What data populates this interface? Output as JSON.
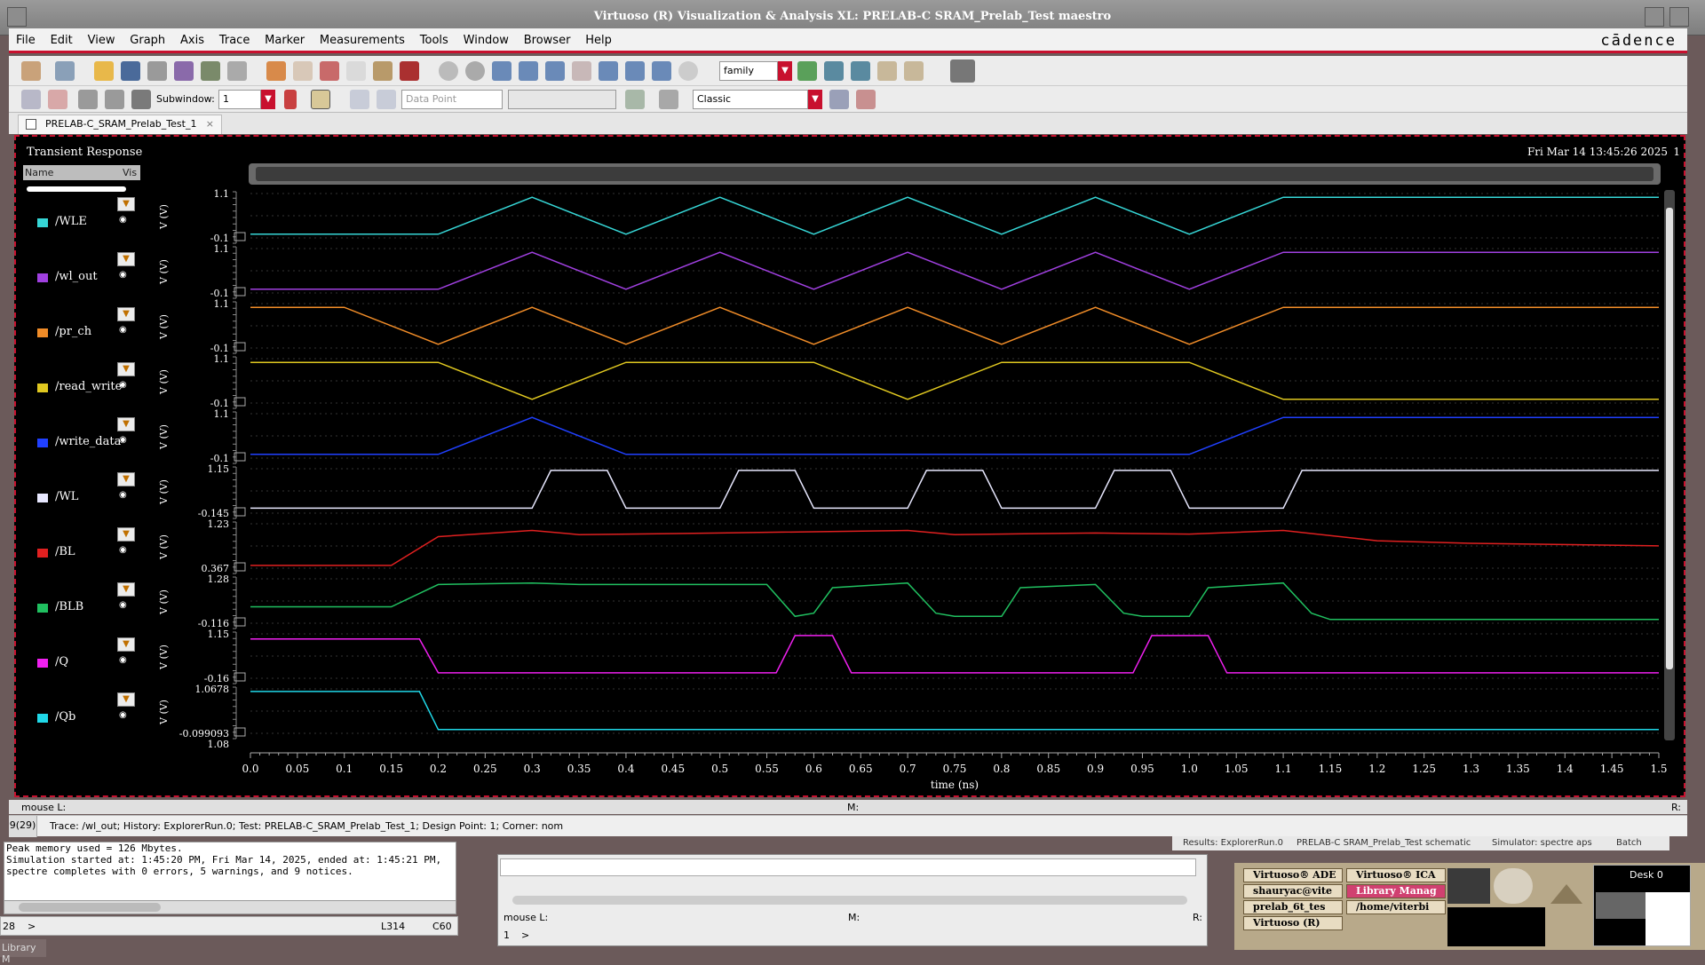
{
  "window": {
    "title": "Virtuoso (R) Visualization & Analysis XL: PRELAB-C SRAM_Prelab_Test maestro"
  },
  "menu": {
    "items": [
      "File",
      "Edit",
      "View",
      "Graph",
      "Axis",
      "Trace",
      "Marker",
      "Measurements",
      "Tools",
      "Window",
      "Browser",
      "Help"
    ],
    "logo": "cādence"
  },
  "toolbar": {
    "family_select": "family",
    "subwindow_label": "Subwindow:",
    "subwindow_value": "1",
    "datapoint_select": "Data Point",
    "style_select": "Classic"
  },
  "tab": {
    "label": "PRELAB-C_SRAM_Prelab_Test_1"
  },
  "plot": {
    "title": "Transient Response",
    "date": "Fri Mar 14 13:45:26 2025",
    "corner_mark": "1",
    "legend_header_name": "Name",
    "legend_header_vis": "Vis",
    "axis_unit_label": "V (V)",
    "extra_axis_top": "1.08"
  },
  "chart_data": {
    "type": "line",
    "xlabel": "time (ns)",
    "xlim": [
      0.0,
      1.5
    ],
    "x_ticks": [
      "0.0",
      "0.05",
      "0.1",
      "0.15",
      "0.2",
      "0.25",
      "0.3",
      "0.35",
      "0.4",
      "0.45",
      "0.5",
      "0.55",
      "0.6",
      "0.65",
      "0.7",
      "0.75",
      "0.8",
      "0.85",
      "0.9",
      "0.95",
      "1.0",
      "1.05",
      "1.1",
      "1.15",
      "1.2",
      "1.25",
      "1.3",
      "1.35",
      "1.4",
      "1.45",
      "1.5"
    ],
    "series": [
      {
        "name": "/WLE",
        "color": "#36d6d6",
        "ymax_label": "1.1",
        "ymin_label": "-0.1",
        "ylim": [
          -0.1,
          1.1
        ],
        "x": [
          0,
          0.2,
          0.3,
          0.4,
          0.5,
          0.6,
          0.7,
          0.8,
          0.9,
          1.0,
          1.1,
          1.5
        ],
        "y": [
          0,
          0,
          1,
          0,
          1,
          0,
          1,
          0,
          1,
          0,
          1,
          1
        ]
      },
      {
        "name": "/wl_out",
        "color": "#a040e0",
        "ymax_label": "1.1",
        "ymin_label": "-0.1",
        "ylim": [
          -0.1,
          1.1
        ],
        "x": [
          0,
          0.2,
          0.3,
          0.4,
          0.5,
          0.6,
          0.7,
          0.8,
          0.9,
          1.0,
          1.1,
          1.5
        ],
        "y": [
          0,
          0,
          1,
          0,
          1,
          0,
          1,
          0,
          1,
          0,
          1,
          1
        ]
      },
      {
        "name": "/pr_ch",
        "color": "#f08c28",
        "ymax_label": "1.1",
        "ymin_label": "-0.1",
        "ylim": [
          -0.1,
          1.1
        ],
        "x": [
          0,
          0.1,
          0.2,
          0.3,
          0.4,
          0.5,
          0.6,
          0.7,
          0.8,
          0.9,
          1.0,
          1.1,
          1.5
        ],
        "y": [
          1,
          1,
          0,
          1,
          0,
          1,
          0,
          1,
          0,
          1,
          0,
          1,
          1
        ]
      },
      {
        "name": "/read_write",
        "color": "#e0c820",
        "ymax_label": "1.1",
        "ymin_label": "-0.1",
        "ylim": [
          -0.1,
          1.1
        ],
        "x": [
          0,
          0.2,
          0.3,
          0.4,
          0.6,
          0.7,
          0.8,
          1.0,
          1.1,
          1.5
        ],
        "y": [
          1,
          1,
          0,
          1,
          1,
          0,
          1,
          1,
          0,
          0
        ]
      },
      {
        "name": "/write_data",
        "color": "#2040ff",
        "ymax_label": "1.1",
        "ymin_label": "-0.1",
        "ylim": [
          -0.1,
          1.1
        ],
        "x": [
          0,
          0.2,
          0.3,
          0.4,
          1.0,
          1.1,
          1.5
        ],
        "y": [
          0,
          0,
          1,
          0,
          0,
          1,
          1
        ]
      },
      {
        "name": "/WL",
        "color": "#e8e8ff",
        "ymax_label": "1.15",
        "ymin_label": "-0.145",
        "ylim": [
          -0.145,
          1.15
        ],
        "x": [
          0,
          0.3,
          0.32,
          0.38,
          0.4,
          0.5,
          0.52,
          0.58,
          0.6,
          0.7,
          0.72,
          0.78,
          0.8,
          0.9,
          0.92,
          0.98,
          1.0,
          1.1,
          1.12,
          1.5
        ],
        "y": [
          0,
          0,
          1.1,
          1.1,
          0,
          0,
          1.1,
          1.1,
          0,
          0,
          1.1,
          1.1,
          0,
          0,
          1.1,
          1.1,
          0,
          0,
          1.1,
          1.1
        ]
      },
      {
        "name": "/BL",
        "color": "#e02020",
        "ymax_label": "1.23",
        "ymin_label": "0.367",
        "ylim": [
          0.367,
          1.23
        ],
        "x": [
          0,
          0.15,
          0.2,
          0.3,
          0.35,
          0.5,
          0.7,
          0.75,
          0.9,
          1.0,
          1.1,
          1.2,
          1.3,
          1.5
        ],
        "y": [
          0.42,
          0.42,
          0.98,
          1.1,
          1.02,
          1.05,
          1.1,
          1.02,
          1.05,
          1.03,
          1.1,
          0.9,
          0.85,
          0.8
        ]
      },
      {
        "name": "/BLB",
        "color": "#20c060",
        "ymax_label": "1.28",
        "ymin_label": "-0.116",
        "ylim": [
          -0.116,
          1.28
        ],
        "x": [
          0,
          0.15,
          0.2,
          0.3,
          0.35,
          0.5,
          0.55,
          0.58,
          0.6,
          0.62,
          0.7,
          0.73,
          0.75,
          0.8,
          0.82,
          0.9,
          0.93,
          0.95,
          1.0,
          1.02,
          1.1,
          1.13,
          1.15,
          1.5
        ],
        "y": [
          0.4,
          0.4,
          1.1,
          1.15,
          1.1,
          1.1,
          1.1,
          0.1,
          0.2,
          1.0,
          1.15,
          0.2,
          0.1,
          0.1,
          1.0,
          1.1,
          0.2,
          0.1,
          0.1,
          1.0,
          1.15,
          0.2,
          0.0,
          0.0
        ]
      },
      {
        "name": "/Q",
        "color": "#f020f0",
        "ymax_label": "1.15",
        "ymin_label": "-0.16",
        "ylim": [
          -0.16,
          1.15
        ],
        "x": [
          0,
          0.18,
          0.2,
          0.56,
          0.58,
          0.62,
          0.64,
          0.94,
          0.96,
          1.02,
          1.04,
          1.5
        ],
        "y": [
          1.0,
          1.0,
          0,
          0,
          1.1,
          1.1,
          0,
          0,
          1.1,
          1.1,
          0,
          0
        ]
      },
      {
        "name": "/Qb",
        "color": "#20d8e8",
        "ymax_label": "1.0678",
        "ymin_label": "-0.099093",
        "ylim": [
          -0.099093,
          1.0678
        ],
        "x": [
          0,
          0.18,
          0.2,
          1.5
        ],
        "y": [
          1.0,
          1.0,
          0,
          0
        ]
      }
    ]
  },
  "status": {
    "mouse_l": "mouse L:",
    "mouse_m": "M:",
    "mouse_r": "R:",
    "index": "9(29)",
    "trace_info": "Trace: /wl_out; History: ExplorerRun.0; Test: PRELAB-C_SRAM_Prelab_Test_1; Design Point: 1; Corner: nom",
    "results": "Results: ExplorerRun.0",
    "schematic": "PRELAB-C SRAM_Prelab_Test schematic",
    "simulator": "Simulator: spectre aps",
    "batch": "Batch"
  },
  "log": {
    "lines": [
      "Peak memory used = 126 Mbytes.",
      "Simulation started at: 1:45:20 PM, Fri Mar 14, 2025, ended at: 1:45:21 PM,",
      "spectre completes with 0 errors, 5 warnings, and 9 notices."
    ],
    "line_no": "28",
    "prompt": ">",
    "pos_line": "L314",
    "pos_col": "C60"
  },
  "midwin": {
    "mouse_l": "mouse L:",
    "mouse_m": "M:",
    "mouse_r": "R:",
    "line_no": "1",
    "prompt": ">"
  },
  "taskbar": {
    "library_btn": "Library M",
    "tasks": [
      "Virtuoso® ADE",
      "Virtuoso® ICA",
      "shauryac@vite",
      "Library Manag",
      "prelab_6t_tes",
      "/home/viterbi",
      "Virtuoso (R)"
    ],
    "desk": "Desk 0"
  }
}
